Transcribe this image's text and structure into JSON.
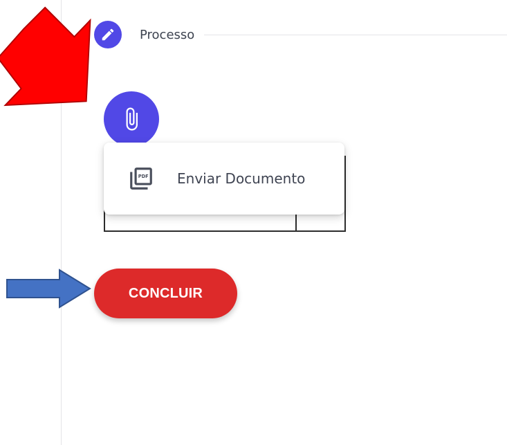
{
  "section": {
    "title": "Processo",
    "icon": "pencil-icon"
  },
  "attach": {
    "icon": "paperclip-icon"
  },
  "menu": {
    "items": [
      {
        "label": "Enviar Documento",
        "icon": "pdf-file-icon"
      }
    ]
  },
  "actions": {
    "conclude_label": "CONCLUIR"
  },
  "colors": {
    "accent": "#5148e6",
    "danger": "#dd2a2a",
    "annotation_red": "#ff0000",
    "annotation_blue": "#4472c4"
  }
}
